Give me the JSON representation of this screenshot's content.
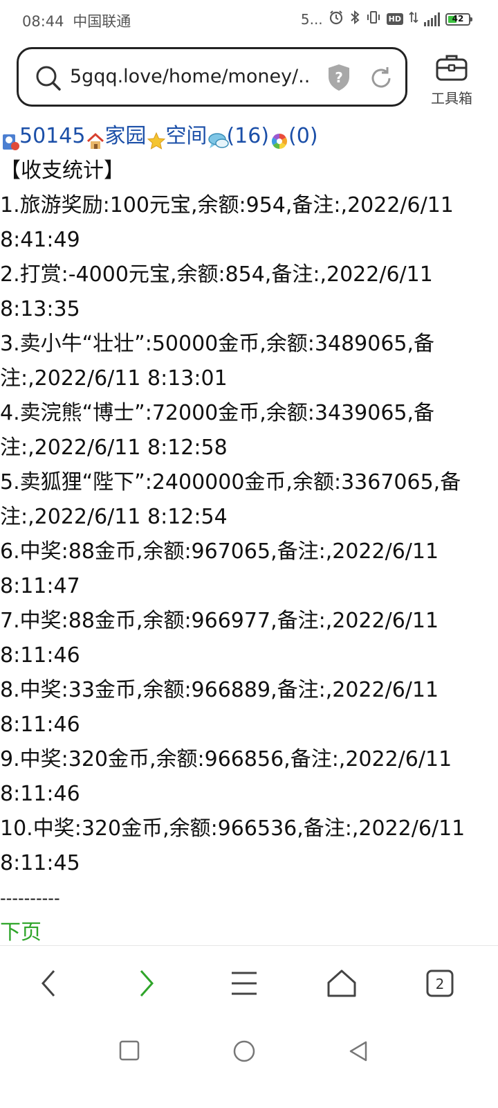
{
  "status_bar": {
    "time": "08:44",
    "carrier": "中国联通",
    "network_text": "5...",
    "hd": "HD",
    "battery": "42",
    "battery_level": 0.42
  },
  "address_bar": {
    "url": "5gqq.love/home/money/...",
    "security_icon_text": "?",
    "toolbox_label": "工具箱"
  },
  "nav_links": {
    "user_id": "50145",
    "home": "家园",
    "space": "空间",
    "messages": "(16)",
    "gallery": "(0)"
  },
  "page": {
    "title": "【收支统计】",
    "records": [
      {
        "line1": "1.旅游奖励:100元宝,余额:954,备注:,2022/6/11",
        "line2": "8:41:49"
      },
      {
        "line1": "2.打赏:-4000元宝,余额:854,备注:,2022/6/11",
        "line2": "8:13:35"
      },
      {
        "line1": "3.卖小牛“壮壮”:50000金币,余额:3489065,备",
        "line2": "注:,2022/6/11 8:13:01"
      },
      {
        "line1": "4.卖浣熊“博士”:72000金币,余额:3439065,备",
        "line2": "注:,2022/6/11 8:12:58"
      },
      {
        "line1": "5.卖狐狸“陛下”:2400000金币,余额:3367065,备",
        "line2": "注:,2022/6/11 8:12:54"
      },
      {
        "line1": "6.中奖:88金币,余额:967065,备注:,2022/6/11",
        "line2": "8:11:47"
      },
      {
        "line1": "7.中奖:88金币,余额:966977,备注:,2022/6/11",
        "line2": "8:11:46"
      },
      {
        "line1": "8.中奖:33金币,余额:966889,备注:,2022/6/11",
        "line2": "8:11:46"
      },
      {
        "line1": "9.中奖:320金币,余额:966856,备注:,2022/6/11",
        "line2": "8:11:46"
      },
      {
        "line1": "10.中奖:320金币,余额:966536,备注:,2022/6/11",
        "line2": "8:11:45"
      }
    ],
    "separator": "----------",
    "next_page": "下页"
  },
  "toolbar": {
    "tab_count": "2"
  },
  "colors": {
    "link_blue": "#1b4fa8",
    "green": "#2fa52a"
  }
}
